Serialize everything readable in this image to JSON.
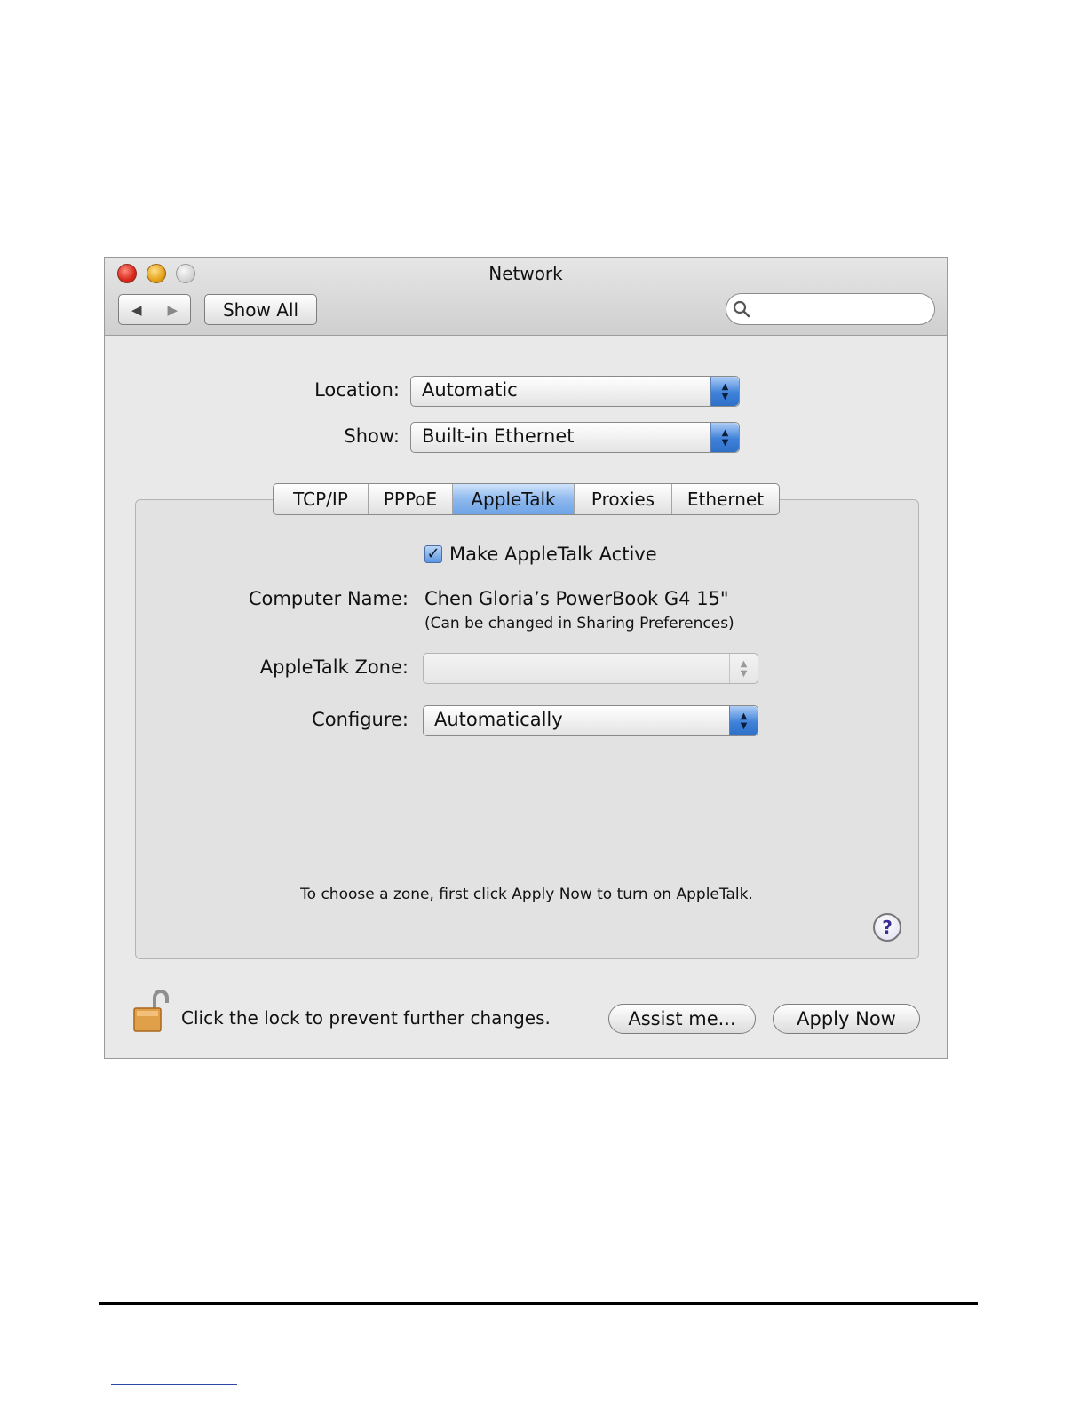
{
  "window": {
    "title": "Network"
  },
  "toolbar": {
    "back_icon": "◀",
    "forward_icon": "▶",
    "show_all_label": "Show All",
    "search_placeholder": "",
    "search_value": ""
  },
  "location": {
    "label": "Location:",
    "value": "Automatic"
  },
  "show": {
    "label": "Show:",
    "value": "Built-in Ethernet"
  },
  "tabs": [
    {
      "label": "TCP/IP"
    },
    {
      "label": "PPPoE"
    },
    {
      "label": "AppleTalk"
    },
    {
      "label": "Proxies"
    },
    {
      "label": "Ethernet"
    }
  ],
  "active_tab": "AppleTalk",
  "appletalk": {
    "active_checkbox_label": "Make AppleTalk Active",
    "active_checked": true,
    "computer_name_label": "Computer Name:",
    "computer_name_value": "Chen Gloria’s PowerBook G4 15\"",
    "computer_name_note": "(Can be changed in Sharing Preferences)",
    "zone_label": "AppleTalk Zone:",
    "zone_value": "",
    "configure_label": "Configure:",
    "configure_value": "Automatically",
    "hint": "To choose a zone, first click Apply Now to turn on AppleTalk."
  },
  "help_icon_glyph": "?",
  "footer": {
    "lock_text": "Click the lock to prevent further changes.",
    "assist_label": "Assist me...",
    "apply_label": "Apply Now"
  },
  "colors": {
    "popup_accent": "#3f82d9",
    "active_tab": "#8fb9ee"
  }
}
